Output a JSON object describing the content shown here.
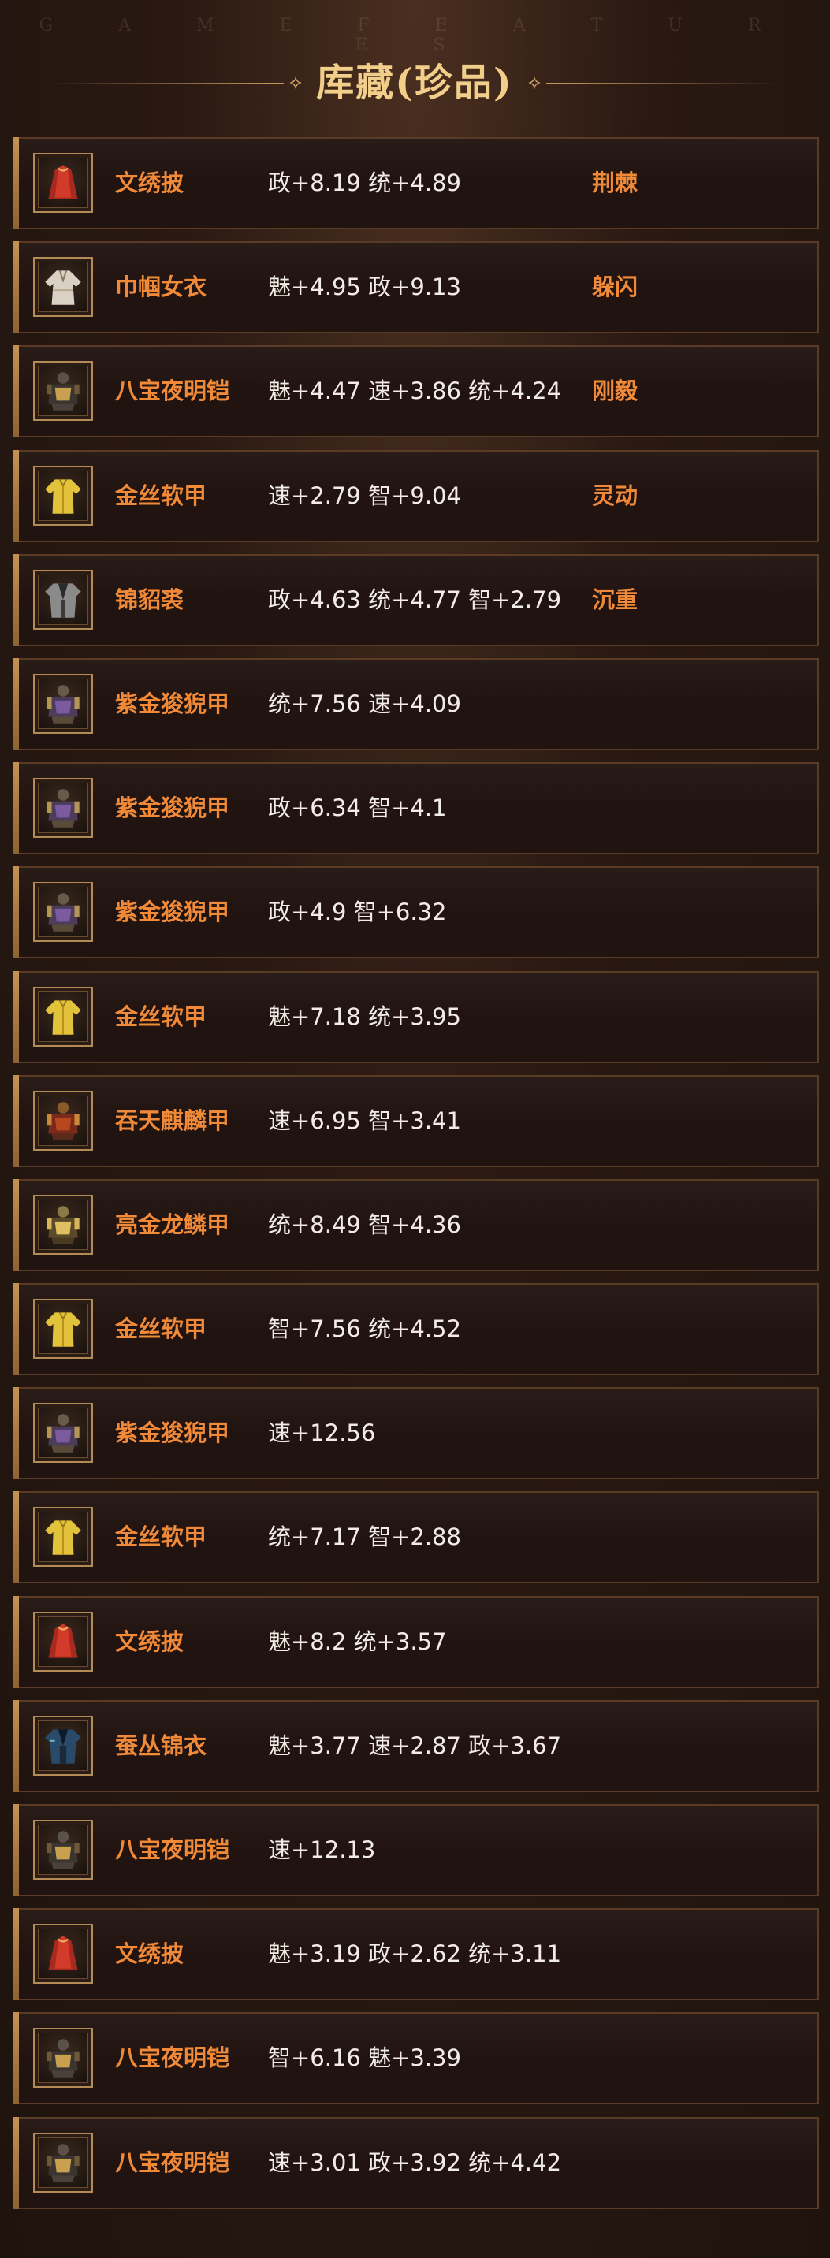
{
  "header": {
    "subtitle": "G A M E   F E A T U R E S",
    "title": "库藏(珍品)"
  },
  "colors": {
    "item_name": "#f08a39",
    "stats_text": "#f2ece6",
    "title": "#f1ce8a",
    "row_bg": "#211310",
    "accent_bar": "#c28f4e"
  },
  "items": [
    {
      "name": "文绣披",
      "stats": "政+8.19 统+4.89",
      "trait": "荆棘",
      "icon": "red-cloak-icon"
    },
    {
      "name": "巾帼女衣",
      "stats": "魅+4.95 政+9.13",
      "trait": "躲闪",
      "icon": "white-robe-icon"
    },
    {
      "name": "八宝夜明铠",
      "stats": "魅+4.47 速+3.86 统+4.24",
      "trait": "刚毅",
      "icon": "dark-armor-icon"
    },
    {
      "name": "金丝软甲",
      "stats": "速+2.79 智+9.04",
      "trait": "灵动",
      "icon": "gold-vest-icon"
    },
    {
      "name": "锦貂裘",
      "stats": "政+4.63 统+4.77 智+2.79",
      "trait": "沉重",
      "icon": "gray-coat-icon"
    },
    {
      "name": "紫金狻猊甲",
      "stats": "统+7.56 速+4.09",
      "trait": "",
      "icon": "purple-armor-icon"
    },
    {
      "name": "紫金狻猊甲",
      "stats": "政+6.34 智+4.1",
      "trait": "",
      "icon": "purple-armor-icon"
    },
    {
      "name": "紫金狻猊甲",
      "stats": "政+4.9 智+6.32",
      "trait": "",
      "icon": "purple-armor-icon"
    },
    {
      "name": "金丝软甲",
      "stats": "魅+7.18 统+3.95",
      "trait": "",
      "icon": "gold-vest-icon"
    },
    {
      "name": "吞天麒麟甲",
      "stats": "速+6.95 智+3.41",
      "trait": "",
      "icon": "red-armor-icon"
    },
    {
      "name": "亮金龙鳞甲",
      "stats": "统+8.49 智+4.36",
      "trait": "",
      "icon": "gold-armor-icon"
    },
    {
      "name": "金丝软甲",
      "stats": "智+7.56 统+4.52",
      "trait": "",
      "icon": "gold-vest-icon"
    },
    {
      "name": "紫金狻猊甲",
      "stats": "速+12.56",
      "trait": "",
      "icon": "purple-armor-icon"
    },
    {
      "name": "金丝软甲",
      "stats": "统+7.17 智+2.88",
      "trait": "",
      "icon": "gold-vest-icon"
    },
    {
      "name": "文绣披",
      "stats": "魅+8.2 统+3.57",
      "trait": "",
      "icon": "red-cloak-icon"
    },
    {
      "name": "蚕丛锦衣",
      "stats": "魅+3.77 速+2.87 政+3.67",
      "trait": "",
      "icon": "blue-robe-icon"
    },
    {
      "name": "八宝夜明铠",
      "stats": "速+12.13",
      "trait": "",
      "icon": "dark-armor-icon"
    },
    {
      "name": "文绣披",
      "stats": "魅+3.19 政+2.62 统+3.11",
      "trait": "",
      "icon": "red-cloak-icon"
    },
    {
      "name": "八宝夜明铠",
      "stats": "智+6.16 魅+3.39",
      "trait": "",
      "icon": "dark-armor-icon"
    },
    {
      "name": "八宝夜明铠",
      "stats": "速+3.01 政+3.92 统+4.42",
      "trait": "",
      "icon": "dark-armor-icon"
    }
  ]
}
